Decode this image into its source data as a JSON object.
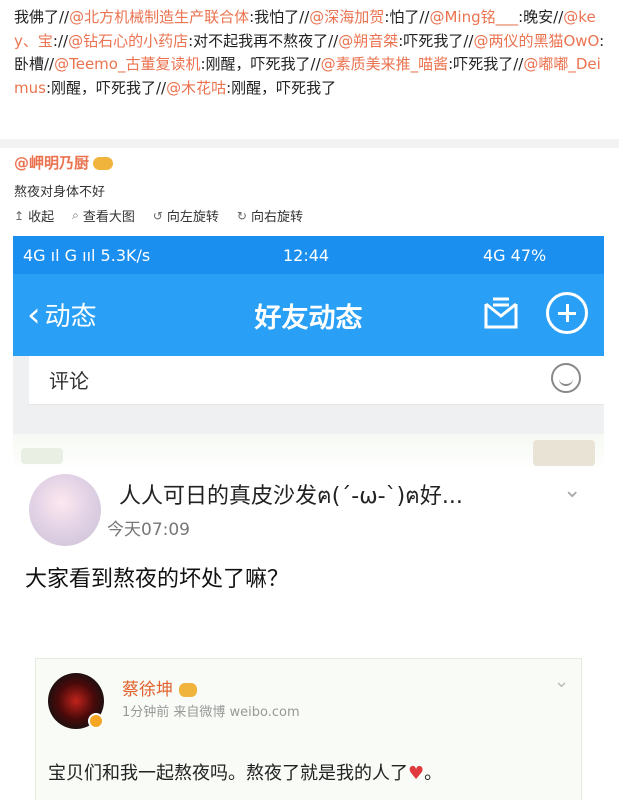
{
  "thread": {
    "segments": [
      {
        "t": "我佛了//",
        "link": false
      },
      {
        "t": "@北方机械制造生产联合体",
        "link": true
      },
      {
        "t": ":我怕了//",
        "link": false
      },
      {
        "t": "@深海加贺",
        "link": true
      },
      {
        "t": ":怕了//",
        "link": false
      },
      {
        "t": "@Ming铭___",
        "link": true
      },
      {
        "t": ":晚安//",
        "link": false
      },
      {
        "t": "@key、宝",
        "link": true
      },
      {
        "t": "://",
        "link": false
      },
      {
        "t": "@钻石心的小药店",
        "link": true
      },
      {
        "t": ":对不起我再不熬夜了//",
        "link": false
      },
      {
        "t": "@朔音桀",
        "link": true
      },
      {
        "t": ":吓死我了//",
        "link": false
      },
      {
        "t": "@两仪的黑猫OwO",
        "link": true
      },
      {
        "t": ":卧槽//",
        "link": false
      },
      {
        "t": "@Teemo_古董复读机",
        "link": true
      },
      {
        "t": ":刚醒，吓死我了//",
        "link": false
      },
      {
        "t": "@素质美来推_喵酱",
        "link": true
      },
      {
        "t": ":吓死我了//",
        "link": false
      },
      {
        "t": "@嘟嘟_Deimus",
        "link": true
      },
      {
        "t": ":刚醒，吓死我了//",
        "link": false
      },
      {
        "t": "@木花咕",
        "link": true
      },
      {
        "t": ":刚醒，吓死我了",
        "link": false
      }
    ]
  },
  "author": {
    "handle": "@岬明乃厨",
    "caption": "熬夜对身体不好"
  },
  "image_tools": {
    "collapse": {
      "icon": "↥",
      "label": "收起"
    },
    "view_large": {
      "icon": "⌕",
      "label": "查看大图"
    },
    "rotate_left": {
      "icon": "↺",
      "label": "向左旋转"
    },
    "rotate_right": {
      "icon": "↻",
      "label": "向右旋转"
    }
  },
  "phone": {
    "status": {
      "left": "4G ıl  G ııl  5.3K/s",
      "time": "12:44",
      "right": "4G  47%"
    },
    "nav": {
      "back_icon": "‹",
      "back_label": "动态",
      "title": "好友动态"
    },
    "comment_label": "评论",
    "post": {
      "name": "人人可日的真皮沙发ฅ(´-ω-`)ฅ好...",
      "time": "今天07:09",
      "text": "大家看到熬夜的坏处了嘛？",
      "chevron": "⌄"
    },
    "weibo": {
      "name": "蔡徐坤",
      "meta": "1分钟前  来自微博 weibo.com",
      "chevron": "⌄",
      "text": "宝贝们和我一起熬夜吗。熬夜了就是我的人了",
      "heart": "♥"
    }
  }
}
